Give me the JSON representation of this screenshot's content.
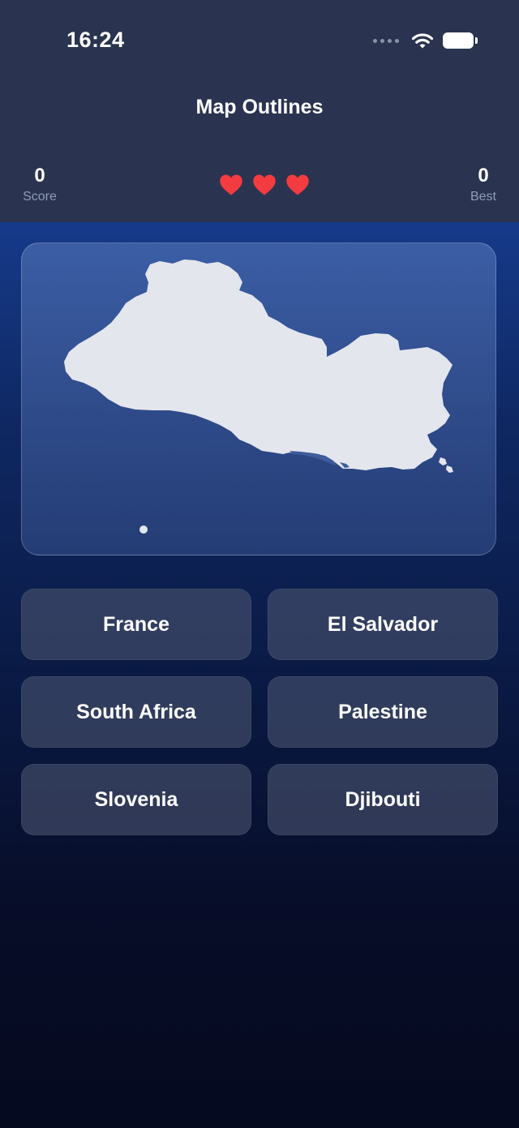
{
  "status_bar": {
    "time": "16:24",
    "icons": [
      "cellular-signal-icon",
      "wifi-icon",
      "battery-icon"
    ]
  },
  "header": {
    "title": "Map Outlines"
  },
  "stats": {
    "score_value": "0",
    "score_label": "Score",
    "best_value": "0",
    "best_label": "Best",
    "lives": 3
  },
  "map": {
    "country_outline": "El Salvador"
  },
  "answers": [
    "France",
    "El Salvador",
    "South Africa",
    "Palestine",
    "Slovenia",
    "Djibouti"
  ],
  "colors": {
    "header_background": "#2a3450",
    "heart": "#f23c40",
    "outline_fill": "#e4e6ee"
  }
}
